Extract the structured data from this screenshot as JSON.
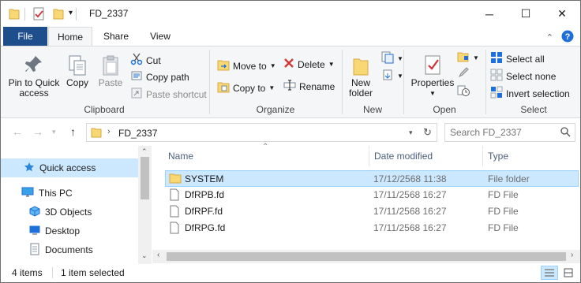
{
  "window": {
    "title": "FD_2337",
    "controls": {
      "minimize": "─",
      "maximize": "☐",
      "close": "✕"
    }
  },
  "tabs": [
    {
      "label": "File"
    },
    {
      "label": "Home"
    },
    {
      "label": "Share"
    },
    {
      "label": "View"
    }
  ],
  "ribbon": {
    "clipboard": {
      "label": "Clipboard",
      "pin": "Pin to Quick\naccess",
      "copy": "Copy",
      "paste": "Paste",
      "cut": "Cut",
      "copy_path": "Copy path",
      "paste_shortcut": "Paste shortcut"
    },
    "organize": {
      "label": "Organize",
      "move_to": "Move to",
      "copy_to": "Copy to",
      "delete": "Delete",
      "rename": "Rename"
    },
    "new": {
      "label": "New",
      "new_folder": "New\nfolder"
    },
    "open": {
      "label": "Open",
      "properties": "Properties"
    },
    "select": {
      "label": "Select",
      "select_all": "Select all",
      "select_none": "Select none",
      "invert_selection": "Invert selection"
    }
  },
  "address": {
    "path": "FD_2337",
    "search_placeholder": "Search FD_2337"
  },
  "nav_pane": {
    "items": [
      {
        "label": "Quick access",
        "icon": "star-icon"
      },
      {
        "label": "This PC",
        "icon": "monitor-icon"
      },
      {
        "label": "3D Objects",
        "icon": "cube-icon"
      },
      {
        "label": "Desktop",
        "icon": "desktop-icon"
      },
      {
        "label": "Documents",
        "icon": "documents-icon"
      }
    ]
  },
  "file_list": {
    "columns": {
      "name": "Name",
      "date_modified": "Date modified",
      "type": "Type"
    },
    "rows": [
      {
        "name": "SYSTEM",
        "date": "17/12/2568 11:38",
        "type": "File folder",
        "icon": "folder-icon",
        "selected": true
      },
      {
        "name": "DfRPB.fd",
        "date": "17/11/2568 16:27",
        "type": "FD File",
        "icon": "file-icon",
        "selected": false
      },
      {
        "name": "DfRPF.fd",
        "date": "17/11/2568 16:27",
        "type": "FD File",
        "icon": "file-icon",
        "selected": false
      },
      {
        "name": "DfRPG.fd",
        "date": "17/11/2568 16:27",
        "type": "FD File",
        "icon": "file-icon",
        "selected": false
      }
    ]
  },
  "status": {
    "item_count": "4 items",
    "selection": "1 item selected"
  },
  "colors": {
    "file_tab": "#1e4e8c",
    "selection": "#cce8ff",
    "folder": "#f8d775"
  }
}
